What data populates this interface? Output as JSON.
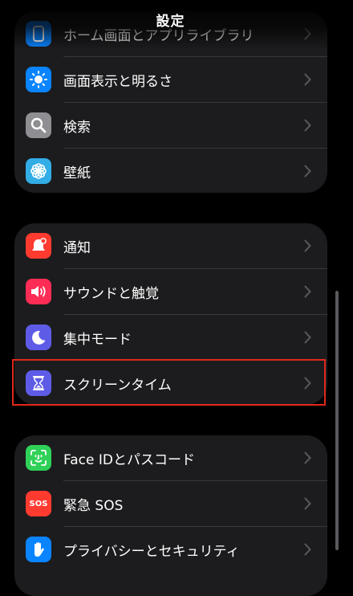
{
  "header": {
    "title": "設定"
  },
  "group1": {
    "items": [
      {
        "label": "ホーム画面とアプリライブラリ",
        "icon": "home-screen-icon",
        "color": "#0a84ff"
      },
      {
        "label": "画面表示と明るさ",
        "icon": "sun-icon",
        "color": "#0a84ff"
      },
      {
        "label": "検索",
        "icon": "magnifier-icon",
        "color": "#8e8e93"
      },
      {
        "label": "壁紙",
        "icon": "flower-icon",
        "color": "#32ade6"
      }
    ]
  },
  "group2": {
    "items": [
      {
        "label": "通知",
        "icon": "bell-icon",
        "color": "#ff3b30"
      },
      {
        "label": "サウンドと触覚",
        "icon": "speaker-icon",
        "color": "#ff2d55"
      },
      {
        "label": "集中モード",
        "icon": "moon-icon",
        "color": "#5e5ce6"
      },
      {
        "label": "スクリーンタイム",
        "icon": "hourglass-icon",
        "color": "#5e5ce6"
      }
    ]
  },
  "group3": {
    "items": [
      {
        "label": "Face IDとパスコード",
        "icon": "face-id-icon",
        "color": "#30d158"
      },
      {
        "label": "緊急 SOS",
        "icon": "sos-icon",
        "color": "#ff3b30",
        "badge": "SOS"
      },
      {
        "label": "プライバシーとセキュリティ",
        "icon": "hand-icon",
        "color": "#0a84ff"
      }
    ]
  }
}
